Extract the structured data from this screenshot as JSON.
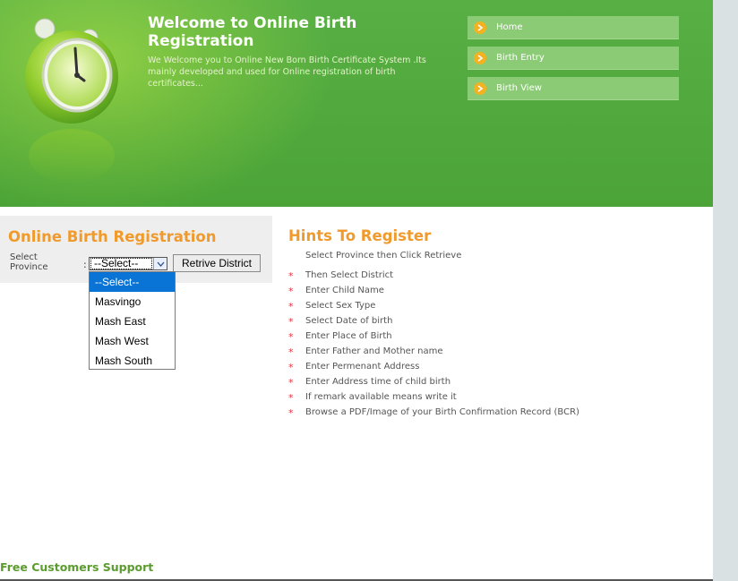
{
  "header": {
    "title": "Welcome to Online Birth Registration",
    "description": "We Welcome you to Online New Born Birth Certificate System .Its mainly developed and used for Online registration of birth certificates..."
  },
  "nav": {
    "items": [
      {
        "label": "Home",
        "icon": "arrow-bullet-icon"
      },
      {
        "label": "Birth Entry",
        "icon": "arrow-bullet-icon"
      },
      {
        "label": "Birth View",
        "icon": "arrow-bullet-icon"
      }
    ]
  },
  "form": {
    "title": "Online Birth Registration",
    "province_label": "Select Province",
    "colon": ":",
    "select_value": "--Select--",
    "retrieve_label": "Retrive District",
    "options": [
      "--Select--",
      "Masvingo",
      "Mash East",
      "Mash West",
      "Mash South"
    ],
    "selected_option_index": 0
  },
  "hints": {
    "title": "Hints To Register",
    "items": [
      "Select Province then Click Retrieve",
      "Then Select District",
      "Enter Child Name",
      "Select Sex Type",
      "Select Date of birth",
      "Enter Place of Birth",
      "Enter Father and Mother name",
      "Enter Permenant Address",
      "Enter Address time of child birth",
      "If remark available means write it",
      "Browse a PDF/Image of your Birth Confirmation Record (BCR)"
    ],
    "star": "*"
  },
  "footer": {
    "support": "Free Customers Support"
  },
  "colors": {
    "header_green": "#4fab3a",
    "accent_orange": "#f09a2c",
    "nav_bg": "#8bcb76",
    "selected_option": "#0a74d6"
  }
}
